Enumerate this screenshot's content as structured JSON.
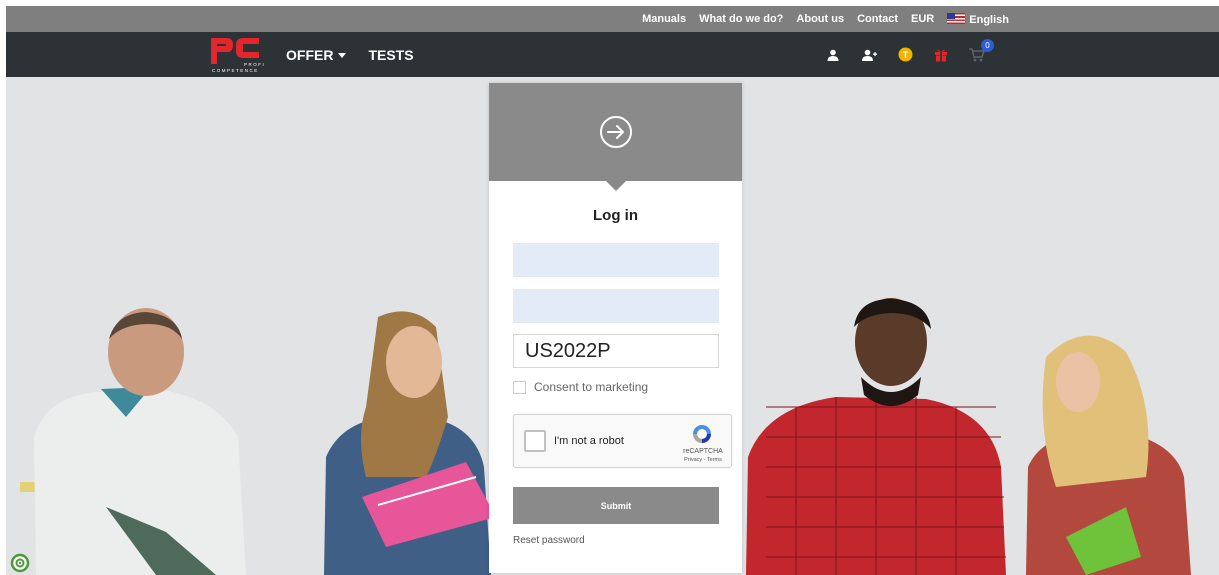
{
  "topbar": {
    "links": [
      "Manuals",
      "What do we do?",
      "About us",
      "Contact",
      "EUR"
    ],
    "language": "English"
  },
  "logo": {
    "sub1": "PROFI",
    "sub2": "COMPETENCE"
  },
  "nav": {
    "offer": "OFFER",
    "tests": "TESTS",
    "cart_count": "0"
  },
  "login": {
    "title": "Log in",
    "field1_value": "",
    "field2_value": "",
    "code_value": "US2022P",
    "consent_label": "Consent to marketing",
    "recaptcha_label": "I'm not a robot",
    "recaptcha_brand": "reCAPTCHA",
    "recaptcha_terms": "Privacy - Terms",
    "submit_label": "Submit",
    "reset_label": "Reset password"
  },
  "colors": {
    "topbar": "#7f7f7f",
    "navbar": "#2d3237",
    "logo_red": "#e3262b",
    "card_header": "#8a8a8a",
    "field_fill": "#e3ebf6"
  },
  "icons": [
    "user-icon",
    "add-user-icon",
    "coin-icon",
    "gift-icon",
    "cart-icon",
    "login-arrow-icon",
    "accessibility-icon"
  ]
}
